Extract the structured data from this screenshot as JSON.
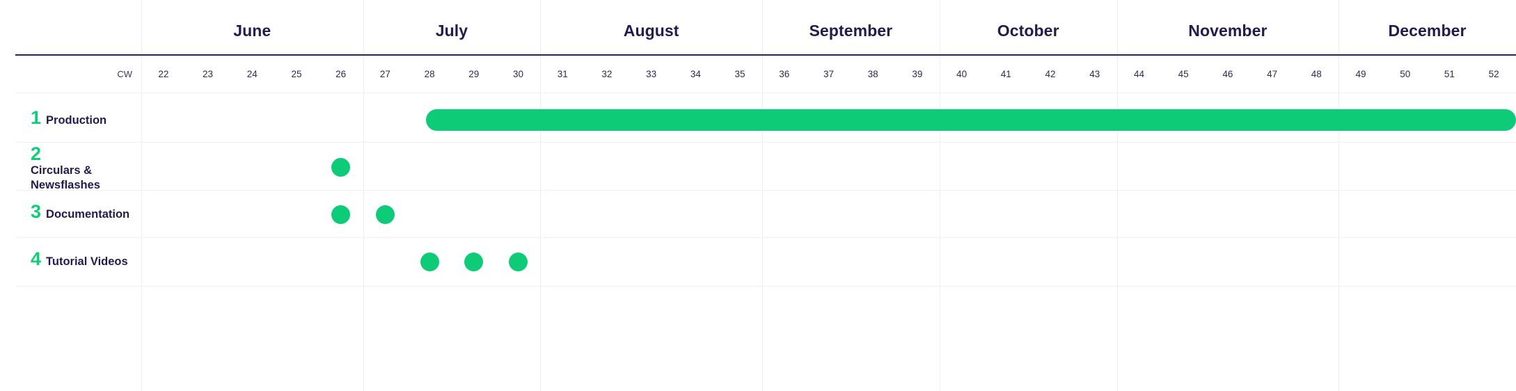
{
  "chart_data": {
    "type": "bar",
    "title": "",
    "xlabel": "CW",
    "ylabel": "",
    "grid": true,
    "legend": "none",
    "orientation": "horizontal-gantt",
    "axis": {
      "cw_header_label": "CW",
      "week_range": [
        22,
        52
      ],
      "weeks": [
        22,
        23,
        24,
        25,
        26,
        27,
        28,
        29,
        30,
        31,
        32,
        33,
        34,
        35,
        36,
        37,
        38,
        39,
        40,
        41,
        42,
        43,
        44,
        45,
        46,
        47,
        48,
        49,
        50,
        51,
        52
      ],
      "months": [
        {
          "name": "June",
          "weeks": [
            22,
            23,
            24,
            25,
            26
          ]
        },
        {
          "name": "July",
          "weeks": [
            27,
            28,
            29,
            30
          ]
        },
        {
          "name": "August",
          "weeks": [
            31,
            32,
            33,
            34,
            35
          ]
        },
        {
          "name": "September",
          "weeks": [
            36,
            37,
            38,
            39
          ]
        },
        {
          "name": "October",
          "weeks": [
            40,
            41,
            42,
            43
          ]
        },
        {
          "name": "November",
          "weeks": [
            44,
            45,
            46,
            47,
            48
          ]
        },
        {
          "name": "December",
          "weeks": [
            49,
            50,
            51,
            52
          ]
        }
      ]
    },
    "categories": [
      "Production",
      "Circulars & Newsflashes",
      "Documentation",
      "Tutorial Videos"
    ],
    "series": [
      {
        "name": "Production",
        "number": "1",
        "type": "bar",
        "start_week": 28,
        "end_week": 52,
        "continues_right": true,
        "milestones": []
      },
      {
        "name": "Circulars & Newsflashes",
        "number": "2",
        "type": "milestone",
        "milestones": [
          26
        ]
      },
      {
        "name": "Documentation",
        "number": "3",
        "type": "milestone",
        "milestones": [
          26,
          27
        ]
      },
      {
        "name": "Tutorial Videos",
        "number": "4",
        "type": "milestone",
        "milestones": [
          28,
          29,
          30
        ]
      }
    ]
  },
  "header": {
    "cw_label": "CW",
    "months": [
      "June",
      "July",
      "August",
      "September",
      "October",
      "November",
      "December"
    ],
    "weeks": [
      "22",
      "23",
      "24",
      "25",
      "26",
      "27",
      "28",
      "29",
      "30",
      "31",
      "32",
      "33",
      "34",
      "35",
      "36",
      "37",
      "38",
      "39",
      "40",
      "41",
      "42",
      "43",
      "44",
      "45",
      "46",
      "47",
      "48",
      "49",
      "50",
      "51",
      "52"
    ]
  },
  "rows": [
    {
      "number": "1",
      "title": "Production"
    },
    {
      "number": "2",
      "title": "Circulars & Newsflashes"
    },
    {
      "number": "3",
      "title": "Documentation"
    },
    {
      "number": "4",
      "title": "Tutorial Videos"
    }
  ],
  "colors": {
    "accent_green": "#0ecb78",
    "number_green": "#10cd78",
    "text_dark": "#231a4d",
    "rule_dark": "#2e2352",
    "grid_line": "#eceef2",
    "row_line": "#f0f1f4",
    "background": "#ffffff"
  }
}
